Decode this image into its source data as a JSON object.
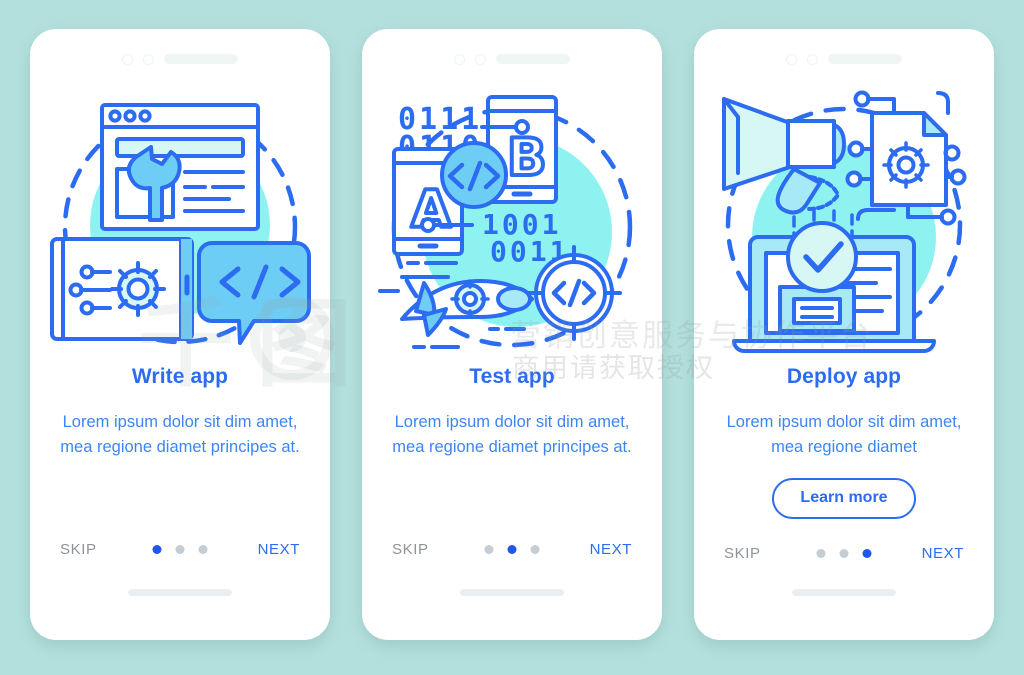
{
  "background_color": "#b3e0dd",
  "accent_color": "#2b6cf0",
  "body_text_color": "#3c85f5",
  "muted_color": "#8e9499",
  "illustration": {
    "stroke": "#2b6cf0",
    "fill_light": "#a8e9f7",
    "fill_mid": "#6ecdf5",
    "fill_pale": "#d6f7f3",
    "blob": "#7af0ef"
  },
  "screens": [
    {
      "id": "write-app",
      "title": "Write app",
      "desc": "Lorem ipsum dolor sit dim amet, mea regione diamet principes at.",
      "skip_label": "SKIP",
      "next_label": "NEXT",
      "active_dot": 0,
      "dot_count": 3,
      "has_cta": false,
      "cta_label": "",
      "icon_names": [
        "browser-window-icon",
        "wrench-icon",
        "tablet-gear-icon",
        "code-bubble-icon"
      ]
    },
    {
      "id": "test-app",
      "title": "Test app",
      "desc": "Lorem ipsum dolor sit dim amet, mea regione diamet principes at.",
      "skip_label": "SKIP",
      "next_label": "NEXT",
      "active_dot": 1,
      "dot_count": 3,
      "has_cta": false,
      "cta_label": "",
      "binary_top": "0111 0110",
      "binary_mid": "1001 0011",
      "phone_a_label": "A",
      "phone_b_label": "B",
      "icon_names": [
        "phone-a-icon",
        "phone-b-icon",
        "code-badge-icon",
        "rocket-gear-icon",
        "code-target-icon"
      ]
    },
    {
      "id": "deploy-app",
      "title": "Deploy app",
      "desc": "Lorem ipsum dolor sit dim amet, mea regione diamet",
      "skip_label": "SKIP",
      "next_label": "NEXT",
      "active_dot": 2,
      "dot_count": 3,
      "has_cta": true,
      "cta_label": "Learn more",
      "icon_names": [
        "megaphone-icon",
        "document-gear-chip-icon",
        "laptop-icon",
        "check-circle-icon"
      ]
    }
  ],
  "watermark": {
    "logo_text": "千图",
    "line1": "营销创意服务与协作平台",
    "line2": "商用请获取授权"
  }
}
